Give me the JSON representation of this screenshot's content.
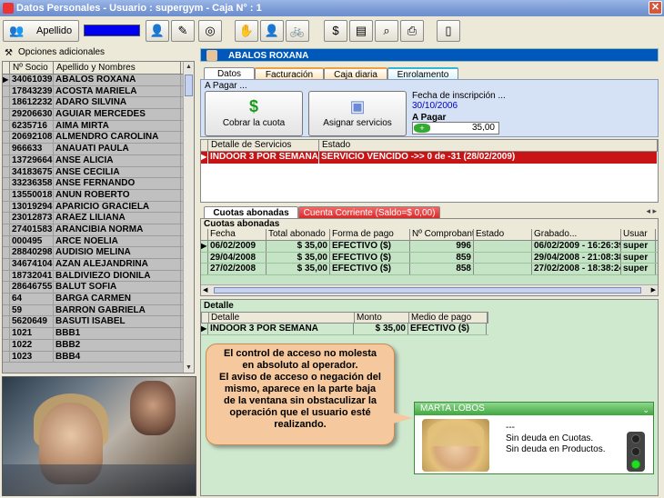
{
  "window": {
    "title": "Datos Personales - Usuario : supergym - Caja N° : 1",
    "close_glyph": "✕"
  },
  "toolbar": {
    "apellido_label": "Apellido",
    "buttons": [
      {
        "name": "person-icon",
        "glyph": "👤"
      },
      {
        "name": "edit-icon",
        "glyph": "✎"
      },
      {
        "name": "target-icon",
        "glyph": "◎"
      },
      {
        "name": "hand-icon",
        "glyph": "✋"
      },
      {
        "name": "user-edit-icon",
        "glyph": "👤"
      },
      {
        "name": "bicycle-icon",
        "glyph": "🚲"
      },
      {
        "name": "money-icon",
        "glyph": "$"
      },
      {
        "name": "notes-icon",
        "glyph": "▤"
      },
      {
        "name": "binoculars-icon",
        "glyph": "⌕"
      },
      {
        "name": "printer-icon",
        "glyph": "⎙"
      },
      {
        "name": "phone-icon",
        "glyph": "▯"
      }
    ]
  },
  "left": {
    "options_label": "Opciones adicionales",
    "headers": {
      "socio": "Nº Socio",
      "nombre": "Apellido y Nombres"
    },
    "rows": [
      [
        "34061039",
        "ABALOS ROXANA"
      ],
      [
        "17843239",
        "ACOSTA MARIELA"
      ],
      [
        "18612232",
        "ADARO SILVINA"
      ],
      [
        "29206630",
        "AGUIAR MERCEDES"
      ],
      [
        "6235716",
        "AIMA MIRTA"
      ],
      [
        "20692108",
        "ALMENDRO CAROLINA"
      ],
      [
        "966633",
        "ANAUATI PAULA"
      ],
      [
        "13729664",
        "ANSE ALICIA"
      ],
      [
        "34183675",
        "ANSE CECILIA"
      ],
      [
        "33236358",
        "ANSE FERNANDO"
      ],
      [
        "13550018",
        "ANUN ROBERTO"
      ],
      [
        "13019294",
        "APARICIO GRACIELA"
      ],
      [
        "23012873",
        "ARAEZ LILIANA"
      ],
      [
        "27401583",
        "ARANCIBIA NORMA"
      ],
      [
        "000495",
        "ARCE NOELIA"
      ],
      [
        "28840298",
        "AUDISIO MELINA"
      ],
      [
        "34674104",
        "AZAN ALEJANDRINA"
      ],
      [
        "18732041",
        "BALDIVIEZO DIONILA"
      ],
      [
        "28646755",
        "BALUT SOFIA"
      ],
      [
        "64",
        "BARGA CARMEN"
      ],
      [
        "59",
        "BARRON GABRIELA"
      ],
      [
        "5620649",
        "BASUTI ISABEL"
      ],
      [
        "1021",
        "BBB1"
      ],
      [
        "1022",
        "BBB2"
      ],
      [
        "1023",
        "BBB4"
      ]
    ]
  },
  "member": {
    "name": "ABALOS ROXANA"
  },
  "tabs": [
    "Datos",
    "Facturación",
    "Caja diaria",
    "Enrolamento"
  ],
  "apagar": {
    "title": "A Pagar ...",
    "cobrar_label": "Cobrar la cuota",
    "asignar_label": "Asignar servicios",
    "fecha_label": "Fecha de inscripción ...",
    "fecha_value": "30/10/2006",
    "apagar_label": "A Pagar",
    "amount": "35,00"
  },
  "servicios": {
    "headers": [
      "Detalle de Servicios",
      "Estado"
    ],
    "rows": [
      [
        "INDOOR 3 POR SEMANA",
        "SERVICIO VENCIDO ->> 0 de -31 (28/02/2009)"
      ]
    ]
  },
  "mid_tabs": [
    "Cuotas abonadas",
    "Cuenta Corriente (Saldo=$ 0,00)"
  ],
  "nav_glyphs": "◂ ▸",
  "cuotas": {
    "title": "Cuotas abonadas",
    "headers": [
      "Fecha",
      "Total abonado",
      "Forma de pago",
      "Nº Comprobante",
      "Estado",
      "Grabado...",
      "Usuar"
    ],
    "rows": [
      [
        "06/02/2009",
        "$ 35,00",
        "EFECTIVO ($)",
        "996",
        "",
        "06/02/2009 - 16:26:39",
        "super"
      ],
      [
        "29/04/2008",
        "$ 35,00",
        "EFECTIVO ($)",
        "859",
        "",
        "29/04/2008 - 21:08:38",
        "super"
      ],
      [
        "27/02/2008",
        "$ 35,00",
        "EFECTIVO ($)",
        "858",
        "",
        "27/02/2008 - 18:38:24",
        "super"
      ]
    ]
  },
  "detalle": {
    "title": "Detalle",
    "headers": [
      "Detalle",
      "Monto",
      "Medio de pago"
    ],
    "rows": [
      [
        "INDOOR 3 POR SEMANA",
        "$ 35,00",
        "EFECTIVO ($)"
      ]
    ]
  },
  "callout": {
    "lines": [
      "El control de acceso no molesta",
      "en absoluto al operador.",
      "El aviso de acceso o negación del",
      "mismo, aparece en la parte baja",
      "de la ventana sin obstaculizar la",
      "operación que el usuario esté",
      "realizando."
    ]
  },
  "notify": {
    "name": "MARTA LOBOS",
    "dashes": "---",
    "line1": "Sin deuda en Cuotas.",
    "line2": "Sin deuda en Productos."
  },
  "colors": {
    "accent": "#0058ba",
    "alert": "#c81414",
    "highlight_green": "#c5e4c5",
    "callout": "#f6c89d"
  }
}
